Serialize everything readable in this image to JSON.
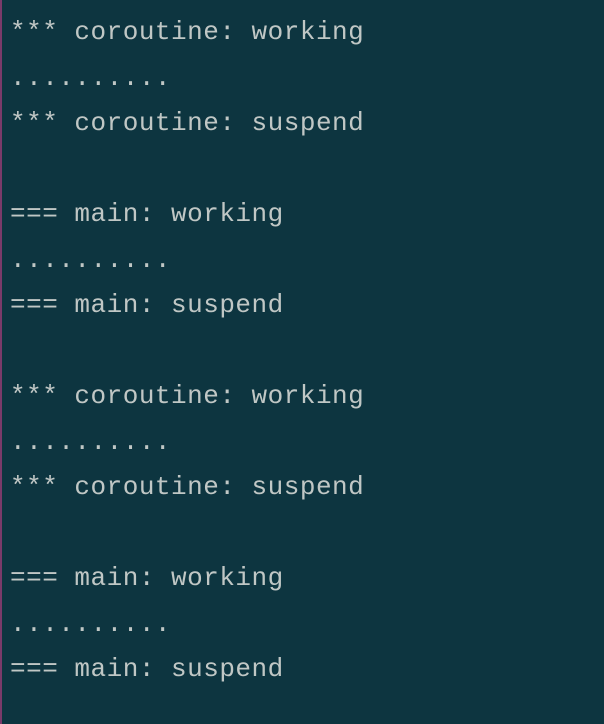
{
  "terminal": {
    "lines": [
      "*** coroutine: working",
      "..........",
      "*** coroutine: suspend",
      "",
      "=== main: working",
      "..........",
      "=== main: suspend",
      "",
      "*** coroutine: working",
      "..........",
      "*** coroutine: suspend",
      "",
      "=== main: working",
      "..........",
      "=== main: suspend"
    ]
  }
}
